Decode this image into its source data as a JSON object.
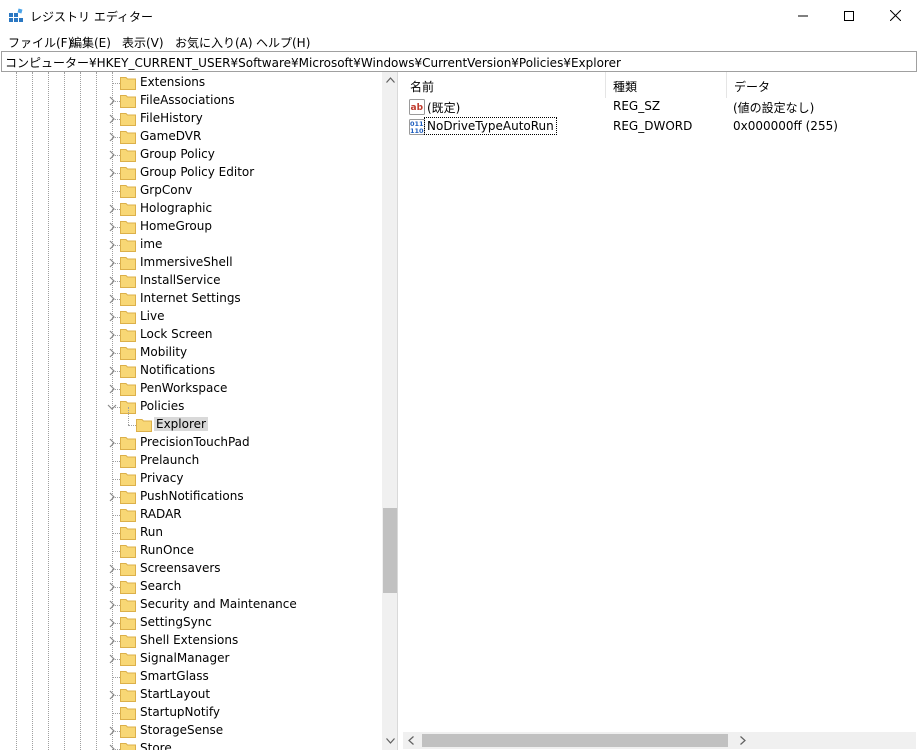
{
  "window": {
    "title": "レジストリ エディター",
    "controls": [
      "minimize",
      "maximize",
      "close"
    ]
  },
  "menu": [
    {
      "label": "ファイル(F)"
    },
    {
      "label": "編集(E)"
    },
    {
      "label": "表示(V)"
    },
    {
      "label": "お気に入り(A)"
    },
    {
      "label": "ヘルプ(H)"
    }
  ],
  "address": {
    "path": "コンピューター¥HKEY_CURRENT_USER¥Software¥Microsoft¥Windows¥CurrentVersion¥Policies¥Explorer"
  },
  "tree": {
    "items": [
      {
        "label": "Extensions",
        "expander": "none",
        "level": 0
      },
      {
        "label": "FileAssociations",
        "expander": "collapsed",
        "level": 0
      },
      {
        "label": "FileHistory",
        "expander": "collapsed",
        "level": 0
      },
      {
        "label": "GameDVR",
        "expander": "collapsed",
        "level": 0
      },
      {
        "label": "Group Policy",
        "expander": "collapsed",
        "level": 0
      },
      {
        "label": "Group Policy Editor",
        "expander": "collapsed",
        "level": 0
      },
      {
        "label": "GrpConv",
        "expander": "none",
        "level": 0
      },
      {
        "label": "Holographic",
        "expander": "collapsed",
        "level": 0
      },
      {
        "label": "HomeGroup",
        "expander": "collapsed",
        "level": 0
      },
      {
        "label": "ime",
        "expander": "collapsed",
        "level": 0
      },
      {
        "label": "ImmersiveShell",
        "expander": "collapsed",
        "level": 0
      },
      {
        "label": "InstallService",
        "expander": "collapsed",
        "level": 0
      },
      {
        "label": "Internet Settings",
        "expander": "collapsed",
        "level": 0
      },
      {
        "label": "Live",
        "expander": "collapsed",
        "level": 0
      },
      {
        "label": "Lock Screen",
        "expander": "collapsed",
        "level": 0
      },
      {
        "label": "Mobility",
        "expander": "collapsed",
        "level": 0
      },
      {
        "label": "Notifications",
        "expander": "collapsed",
        "level": 0
      },
      {
        "label": "PenWorkspace",
        "expander": "collapsed",
        "level": 0
      },
      {
        "label": "Policies",
        "expander": "expanded",
        "level": 0
      },
      {
        "label": "Explorer",
        "expander": "none",
        "level": 1,
        "selected": true
      },
      {
        "label": "PrecisionTouchPad",
        "expander": "collapsed",
        "level": 0
      },
      {
        "label": "Prelaunch",
        "expander": "none",
        "level": 0
      },
      {
        "label": "Privacy",
        "expander": "none",
        "level": 0
      },
      {
        "label": "PushNotifications",
        "expander": "collapsed",
        "level": 0
      },
      {
        "label": "RADAR",
        "expander": "none",
        "level": 0
      },
      {
        "label": "Run",
        "expander": "none",
        "level": 0
      },
      {
        "label": "RunOnce",
        "expander": "none",
        "level": 0
      },
      {
        "label": "Screensavers",
        "expander": "collapsed",
        "level": 0
      },
      {
        "label": "Search",
        "expander": "collapsed",
        "level": 0
      },
      {
        "label": "Security and Maintenance",
        "expander": "collapsed",
        "level": 0
      },
      {
        "label": "SettingSync",
        "expander": "collapsed",
        "level": 0
      },
      {
        "label": "Shell Extensions",
        "expander": "collapsed",
        "level": 0
      },
      {
        "label": "SignalManager",
        "expander": "collapsed",
        "level": 0
      },
      {
        "label": "SmartGlass",
        "expander": "none",
        "level": 0
      },
      {
        "label": "StartLayout",
        "expander": "collapsed",
        "level": 0
      },
      {
        "label": "StartupNotify",
        "expander": "none",
        "level": 0
      },
      {
        "label": "StorageSense",
        "expander": "collapsed",
        "level": 0
      },
      {
        "label": "Store",
        "expander": "collapsed",
        "level": 0
      }
    ]
  },
  "list": {
    "columns": [
      {
        "label": "名前"
      },
      {
        "label": "種類"
      },
      {
        "label": "データ"
      }
    ],
    "rows": [
      {
        "name": "(既定)",
        "type": "REG_SZ",
        "data": "(値の設定なし)",
        "icon": "string-value-icon"
      },
      {
        "name": "NoDriveTypeAutoRun",
        "type": "REG_DWORD",
        "data": "0x000000ff (255)",
        "icon": "binary-value-icon",
        "focused": true
      }
    ]
  },
  "colors": {
    "folder": "#f8d775",
    "folder_edge": "#dcb04a",
    "selection": "#d9d9d9",
    "scroll_track": "#f0f0f0",
    "scroll_thumb": "#c1c1c1"
  }
}
